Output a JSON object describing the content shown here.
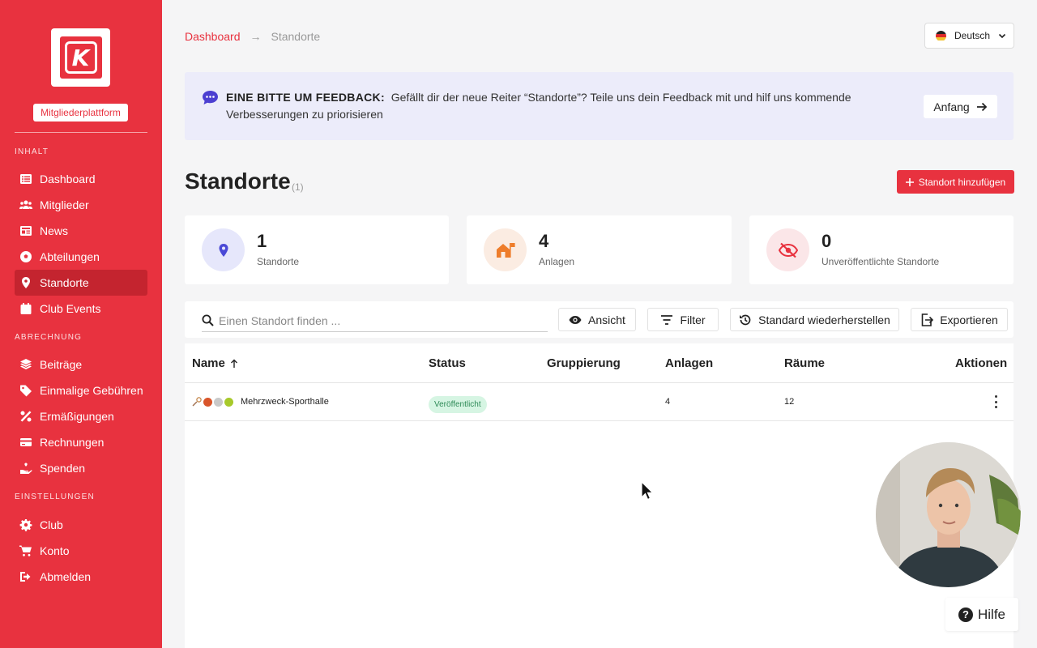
{
  "sidebar": {
    "logo_letter": "K",
    "platform_label": "Mitgliederplattform",
    "section_inhalt": "INHALT",
    "section_abrechnung": "ABRECHNUNG",
    "section_einstellungen": "EINSTELLUNGEN",
    "items": [
      {
        "label": "Dashboard",
        "icon": "list-icon"
      },
      {
        "label": "Mitglieder",
        "icon": "users-icon"
      },
      {
        "label": "News",
        "icon": "newspaper-icon"
      },
      {
        "label": "Abteilungen",
        "icon": "soccer-ball-icon"
      },
      {
        "label": "Standorte",
        "icon": "map-pin-icon",
        "active": true
      },
      {
        "label": "Club Events",
        "icon": "calendar-icon"
      },
      {
        "label": "Beiträge",
        "icon": "layers-icon"
      },
      {
        "label": "Einmalige Gebühren",
        "icon": "tag-icon"
      },
      {
        "label": "Ermäßigungen",
        "icon": "percent-icon"
      },
      {
        "label": "Rechnungen",
        "icon": "credit-card-icon"
      },
      {
        "label": "Spenden",
        "icon": "donation-hand-icon"
      },
      {
        "label": "Club",
        "icon": "gear-icon"
      },
      {
        "label": "Konto",
        "icon": "cart-icon"
      },
      {
        "label": "Abmelden",
        "icon": "logout-icon"
      }
    ]
  },
  "breadcrumb": {
    "home": "Dashboard",
    "separator": "→",
    "current": "Standorte"
  },
  "language": {
    "selected": "Deutsch"
  },
  "feedback": {
    "title": "EINE BITTE UM FEEDBACK:",
    "text": "Gefällt dir der neue Reiter “Standorte”? Teile uns dein Feedback mit und hilf uns kommende Verbesserungen zu priorisieren",
    "button": "Anfang"
  },
  "page": {
    "title": "Standorte",
    "count": "(1)",
    "add_button": "Standort hinzufügen"
  },
  "stats": [
    {
      "value": "1",
      "label": "Standorte",
      "icon": "map-pin-icon"
    },
    {
      "value": "4",
      "label": "Anlagen",
      "icon": "house-flag-icon"
    },
    {
      "value": "0",
      "label": "Unveröffentlichte Standorte",
      "icon": "eye-slash-icon"
    }
  ],
  "toolbar": {
    "search_placeholder": "Einen Standort finden ...",
    "view": "Ansicht",
    "filter": "Filter",
    "reset": "Standard wiederherstellen",
    "export": "Exportieren"
  },
  "table": {
    "headers": {
      "name": "Name",
      "status": "Status",
      "grouping": "Gruppierung",
      "facilities": "Anlagen",
      "rooms": "Räume",
      "actions": "Aktionen"
    },
    "rows": [
      {
        "name": "Mehrzweck-Sporthalle",
        "status": "Veröffentlicht",
        "grouping": "",
        "facilities": "4",
        "rooms": "12"
      }
    ]
  },
  "help": {
    "label": "Hilfe"
  },
  "colors": {
    "brand": "#e8323f",
    "brand_dark": "#c4242f",
    "feedback_bg": "#ececfa",
    "status_green": "#2e8a57"
  }
}
